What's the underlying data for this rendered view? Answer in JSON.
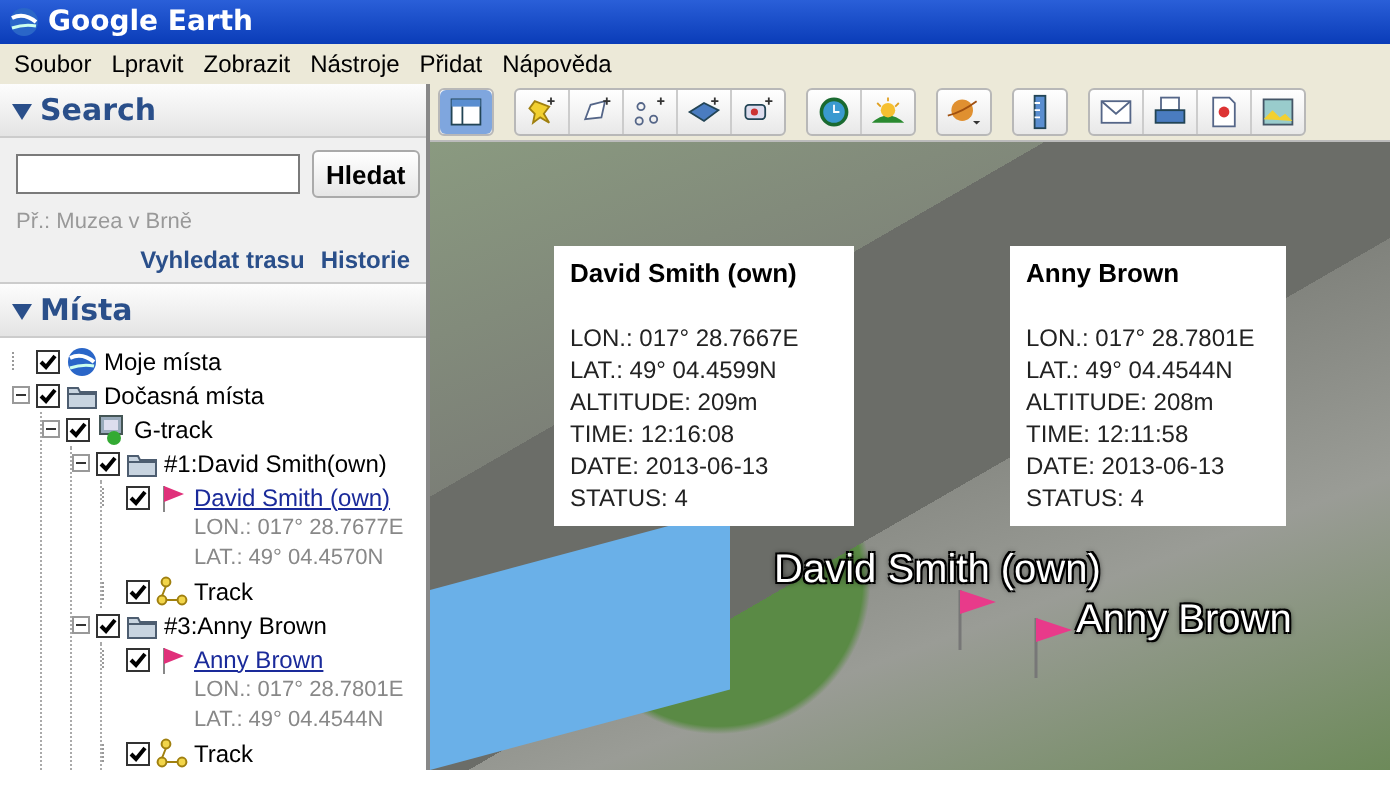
{
  "window": {
    "title": "Google Earth"
  },
  "menu": [
    "Soubor",
    "Lpravit",
    "Zobrazit",
    "Nástroje",
    "Přidat",
    "Nápověda"
  ],
  "search": {
    "heading": "Search",
    "expanded": true,
    "button": "Hledat",
    "hint": "Př.: Muzea v Brně",
    "links": [
      "Vyhledat trasu",
      "Historie"
    ]
  },
  "places": {
    "heading": "Místa",
    "expanded": true,
    "tree": [
      {
        "kind": "globe",
        "label": "Moje místa",
        "checked": true
      },
      {
        "kind": "folder",
        "label": "Dočasná místa",
        "checked": true,
        "expanded": true,
        "children": [
          {
            "kind": "network",
            "label": "G-track",
            "checked": true,
            "expanded": true,
            "children": [
              {
                "kind": "folder",
                "label": "#1:David Smith(own)",
                "checked": true,
                "expanded": true,
                "children": [
                  {
                    "kind": "placemark",
                    "label": "David Smith (own)",
                    "checked": true,
                    "lines": [
                      "LON.: 017° 28.7677E",
                      "LAT.: 49° 04.4570N"
                    ]
                  },
                  {
                    "kind": "track",
                    "label": "Track",
                    "checked": true
                  }
                ]
              },
              {
                "kind": "folder",
                "label": "#3:Anny Brown",
                "checked": true,
                "expanded": true,
                "children": [
                  {
                    "kind": "placemark",
                    "label": "Anny Brown",
                    "checked": true,
                    "lines": [
                      "LON.: 017° 28.7801E",
                      "LAT.: 49° 04.4544N"
                    ]
                  },
                  {
                    "kind": "track",
                    "label": "Track",
                    "checked": true
                  }
                ]
              }
            ]
          }
        ]
      }
    ]
  },
  "toolbar": [
    [
      {
        "kind": "sidebar",
        "selected": true
      }
    ],
    [
      {
        "kind": "placemark",
        "selected": false
      },
      {
        "kind": "polygon",
        "selected": false
      },
      {
        "kind": "path",
        "selected": false
      },
      {
        "kind": "overlay",
        "selected": false
      },
      {
        "kind": "tour",
        "selected": false
      }
    ],
    [
      {
        "kind": "history",
        "selected": false
      },
      {
        "kind": "sun",
        "selected": false
      }
    ],
    [
      {
        "kind": "planet",
        "selected": false
      }
    ],
    [
      {
        "kind": "ruler",
        "selected": false
      }
    ],
    [
      {
        "kind": "email",
        "selected": false
      },
      {
        "kind": "print",
        "selected": false
      },
      {
        "kind": "maps",
        "selected": false
      },
      {
        "kind": "image",
        "selected": false
      }
    ]
  ],
  "map": {
    "balloons": [
      {
        "title": "David Smith (own)",
        "lines": [
          "LON.: 017° 28.7667E",
          "LAT.: 49° 04.4599N",
          "ALTITUDE: 209m",
          "TIME: 12:16:08",
          "DATE: 2013-06-13",
          "STATUS: 4"
        ]
      },
      {
        "title": "Anny Brown",
        "lines": [
          "LON.: 017° 28.7801E",
          "LAT.: 49° 04.4544N",
          "ALTITUDE: 208m",
          "TIME: 12:11:58",
          "DATE: 2013-06-13",
          "STATUS: 4"
        ]
      }
    ],
    "labels": [
      "David Smith (own)",
      "Anny Brown"
    ]
  }
}
